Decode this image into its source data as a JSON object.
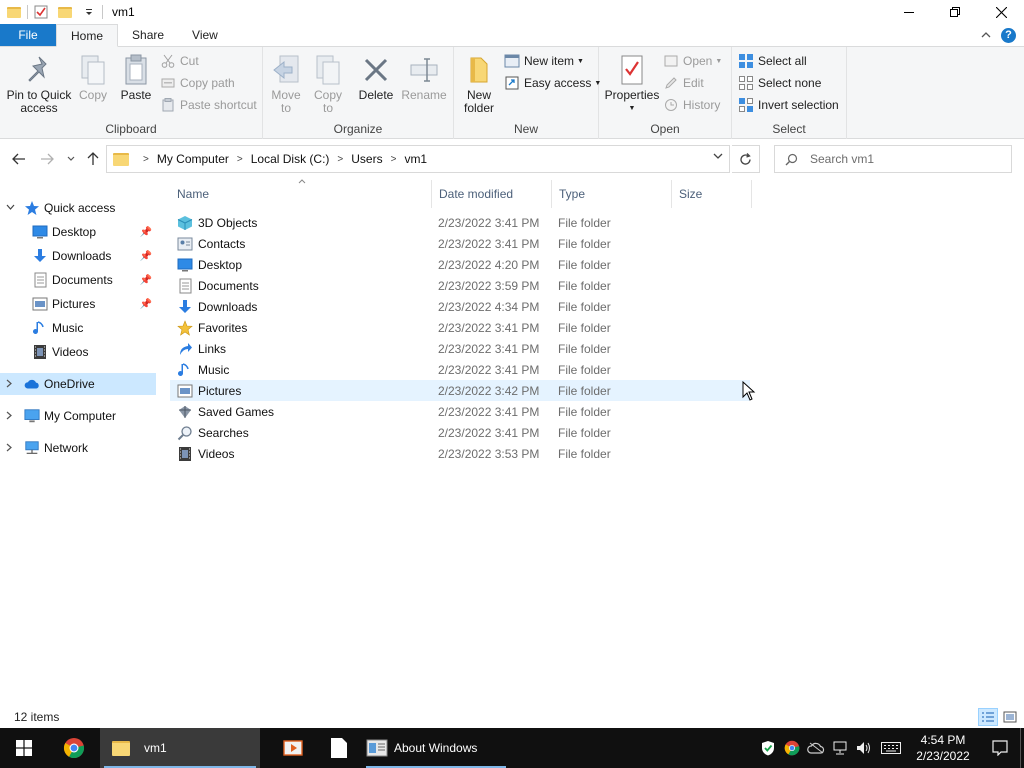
{
  "window": {
    "title": "vm1"
  },
  "ribbon_tabs": [
    {
      "label": "File"
    },
    {
      "label": "Home"
    },
    {
      "label": "Share"
    },
    {
      "label": "View"
    }
  ],
  "clipboard": {
    "group_label": "Clipboard",
    "pin": "Pin to Quick access",
    "copy": "Copy",
    "paste": "Paste",
    "cut": "Cut",
    "copy_path": "Copy path",
    "paste_shortcut": "Paste shortcut"
  },
  "organize": {
    "group_label": "Organize",
    "move_to": "Move to",
    "copy_to": "Copy to",
    "delete": "Delete",
    "rename": "Rename"
  },
  "new": {
    "group_label": "New",
    "new_folder": "New folder",
    "new_item": "New item",
    "easy_access": "Easy access"
  },
  "open": {
    "group_label": "Open",
    "properties": "Properties",
    "open": "Open",
    "edit": "Edit",
    "history": "History"
  },
  "select": {
    "group_label": "Select",
    "select_all": "Select all",
    "select_none": "Select none",
    "invert_selection": "Invert selection"
  },
  "address": {
    "crumbs": [
      "My Computer",
      "Local Disk (C:)",
      "Users",
      "vm1"
    ]
  },
  "search": {
    "placeholder": "Search vm1"
  },
  "navpane": {
    "quick_access": "Quick access",
    "quick_items": [
      {
        "label": "Desktop",
        "icon": "desktop-icon",
        "pinned": true
      },
      {
        "label": "Downloads",
        "icon": "downloads-icon",
        "pinned": true
      },
      {
        "label": "Documents",
        "icon": "documents-icon",
        "pinned": true
      },
      {
        "label": "Pictures",
        "icon": "pictures-icon",
        "pinned": true
      },
      {
        "label": "Music",
        "icon": "music-icon",
        "pinned": false
      },
      {
        "label": "Videos",
        "icon": "videos-icon",
        "pinned": false
      }
    ],
    "onedrive": "OneDrive",
    "my_computer": "My Computer",
    "network": "Network"
  },
  "columns": {
    "name": "Name",
    "date": "Date modified",
    "type": "Type",
    "size": "Size"
  },
  "files": [
    {
      "name": "3D Objects",
      "date": "2/23/2022 3:41 PM",
      "type": "File folder",
      "icon": "3d-objects-icon"
    },
    {
      "name": "Contacts",
      "date": "2/23/2022 3:41 PM",
      "type": "File folder",
      "icon": "contacts-icon"
    },
    {
      "name": "Desktop",
      "date": "2/23/2022 4:20 PM",
      "type": "File folder",
      "icon": "desktop-icon"
    },
    {
      "name": "Documents",
      "date": "2/23/2022 3:59 PM",
      "type": "File folder",
      "icon": "documents-icon"
    },
    {
      "name": "Downloads",
      "date": "2/23/2022 4:34 PM",
      "type": "File folder",
      "icon": "downloads-icon"
    },
    {
      "name": "Favorites",
      "date": "2/23/2022 3:41 PM",
      "type": "File folder",
      "icon": "star-icon"
    },
    {
      "name": "Links",
      "date": "2/23/2022 3:41 PM",
      "type": "File folder",
      "icon": "links-icon"
    },
    {
      "name": "Music",
      "date": "2/23/2022 3:41 PM",
      "type": "File folder",
      "icon": "music-icon"
    },
    {
      "name": "Pictures",
      "date": "2/23/2022 3:42 PM",
      "type": "File folder",
      "icon": "pictures-icon"
    },
    {
      "name": "Saved Games",
      "date": "2/23/2022 3:41 PM",
      "type": "File folder",
      "icon": "saved-games-icon"
    },
    {
      "name": "Searches",
      "date": "2/23/2022 3:41 PM",
      "type": "File folder",
      "icon": "searches-icon"
    },
    {
      "name": "Videos",
      "date": "2/23/2022 3:53 PM",
      "type": "File folder",
      "icon": "videos-icon"
    }
  ],
  "status": {
    "items": "12 items"
  },
  "taskbar": {
    "explorer_label": "vm1",
    "about_label": "About Windows",
    "time": "4:54 PM",
    "date": "2/23/2022"
  },
  "colors": {
    "accent": "#1979ca",
    "selection": "#cce8ff",
    "hover": "#e5f3ff",
    "folder": "#f8d775"
  }
}
